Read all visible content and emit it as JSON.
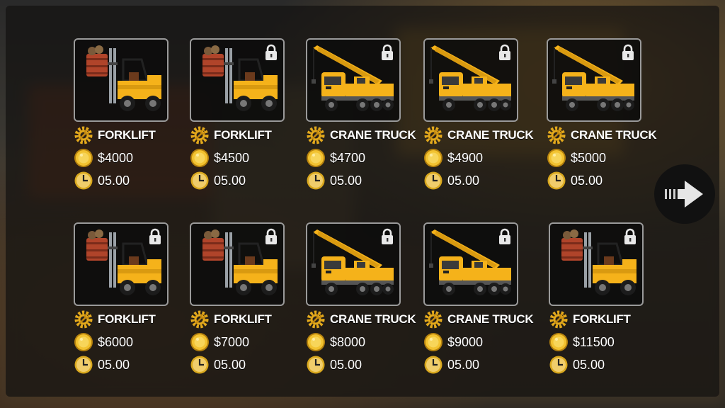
{
  "vehicles": [
    {
      "type": "forklift",
      "name": "FORKLIFT",
      "price": "$4000",
      "time": "05.00",
      "locked": false
    },
    {
      "type": "forklift",
      "name": "FORKLIFT",
      "price": "$4500",
      "time": "05.00",
      "locked": true
    },
    {
      "type": "crane",
      "name": "CRANE TRUCK",
      "price": "$4700",
      "time": "05.00",
      "locked": true
    },
    {
      "type": "crane",
      "name": "CRANE TRUCK",
      "price": "$4900",
      "time": "05.00",
      "locked": true
    },
    {
      "type": "crane",
      "name": "CRANE TRUCK",
      "price": "$5000",
      "time": "05.00",
      "locked": true
    },
    {
      "type": "forklift",
      "name": "FORKLIFT",
      "price": "$6000",
      "time": "05.00",
      "locked": true
    },
    {
      "type": "forklift",
      "name": "FORKLIFT",
      "price": "$7000",
      "time": "05.00",
      "locked": true
    },
    {
      "type": "crane",
      "name": "CRANE TRUCK",
      "price": "$8000",
      "time": "05.00",
      "locked": true
    },
    {
      "type": "crane",
      "name": "CRANE TRUCK",
      "price": "$9000",
      "time": "05.00",
      "locked": true
    },
    {
      "type": "forklift",
      "name": "FORKLIFT",
      "price": "$11500",
      "time": "05.00",
      "locked": true
    }
  ],
  "icons": {
    "name": "gear-wrench-icon",
    "price": "coin-icon",
    "time": "clock-icon",
    "lock": "lock-icon",
    "next": "arrow-right-icon"
  },
  "colors": {
    "vehicle_yellow": "#f5b21a",
    "coin_gold": "#e8b21a",
    "card_border": "#9a9a9a"
  }
}
